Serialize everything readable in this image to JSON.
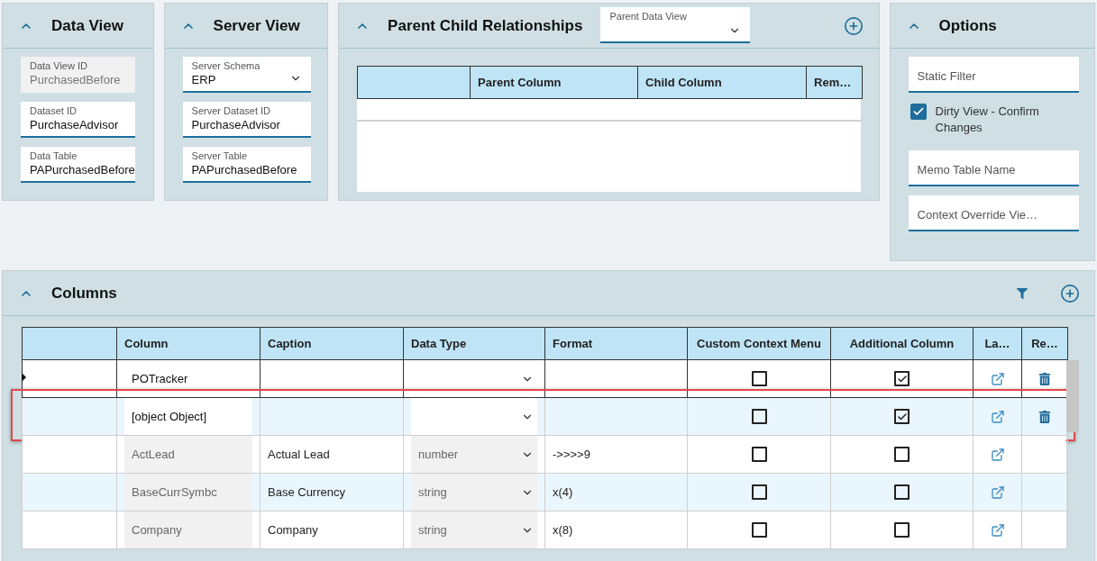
{
  "data_view": {
    "title": "Data View",
    "expanded": true,
    "fields": [
      {
        "label": "Data View ID",
        "value": "PurchasedBefore",
        "kind": "text",
        "disabled": true
      },
      {
        "label": "Dataset ID",
        "value": "PurchaseAdvisor",
        "kind": "text",
        "disabled": false
      },
      {
        "label": "Data Table",
        "value": "PAPurchasedBefore",
        "kind": "text",
        "disabled": false
      }
    ]
  },
  "server_view": {
    "title": "Server View",
    "expanded": true,
    "fields": [
      {
        "label": "Server Schema",
        "value": "ERP",
        "kind": "dropdown",
        "disabled": false
      },
      {
        "label": "Server Dataset ID",
        "value": "PurchaseAdvisor",
        "kind": "text",
        "disabled": false
      },
      {
        "label": "Server Table",
        "value": "PAPurchasedBefore",
        "kind": "text",
        "disabled": false
      }
    ]
  },
  "parent_child": {
    "title": "Parent Child Relationships",
    "expanded": true,
    "parent_data_view": {
      "label": "Parent Data View"
    },
    "table": {
      "columns": [
        "Parent Column",
        "Child Column",
        "Rem…"
      ]
    }
  },
  "options": {
    "title": "Options",
    "expanded": true,
    "fields": [
      {
        "kind": "text",
        "placeholder": "Static Filter"
      },
      {
        "kind": "checkbox",
        "label": "Dirty View - Confirm Changes",
        "checked": true
      },
      {
        "kind": "text",
        "placeholder": "Memo Table Name"
      },
      {
        "kind": "text",
        "placeholder": "Context Override Vie…"
      }
    ]
  },
  "columns_panel": {
    "title": "Columns",
    "expanded": true,
    "table": {
      "columns": [
        "Column",
        "Caption",
        "Data Type",
        "Format",
        "Custom Context Menu",
        "Additional Column",
        "La…",
        "Re…"
      ],
      "rows": [
        {
          "column": "POTracker",
          "locked": false,
          "type_locked": false,
          "custom_context_menu": false,
          "additional_column": true,
          "deletable": true,
          "selected": true,
          "highlighted": false
        },
        {
          "column": "[object Object]",
          "locked": false,
          "type_locked": false,
          "custom_context_menu": false,
          "additional_column": true,
          "deletable": true,
          "selected": false,
          "highlighted": true
        },
        {
          "column": "ActLead",
          "caption": "Actual Lead",
          "data_type": "number",
          "format": "->>>>9",
          "locked": true,
          "type_locked": true,
          "custom_context_menu": false,
          "additional_column": false,
          "deletable": false,
          "selected": false,
          "highlighted": false
        },
        {
          "column": "BaseCurrSymbc",
          "caption": "Base Currency",
          "data_type": "string",
          "format": "x(4)",
          "locked": true,
          "type_locked": true,
          "custom_context_menu": false,
          "additional_column": false,
          "deletable": false,
          "selected": false,
          "highlighted": false
        },
        {
          "column": "Company",
          "caption": "Company",
          "data_type": "string",
          "format": "x(8)",
          "locked": true,
          "type_locked": true,
          "custom_context_menu": false,
          "additional_column": false,
          "deletable": false,
          "selected": false,
          "highlighted": false
        }
      ]
    }
  }
}
